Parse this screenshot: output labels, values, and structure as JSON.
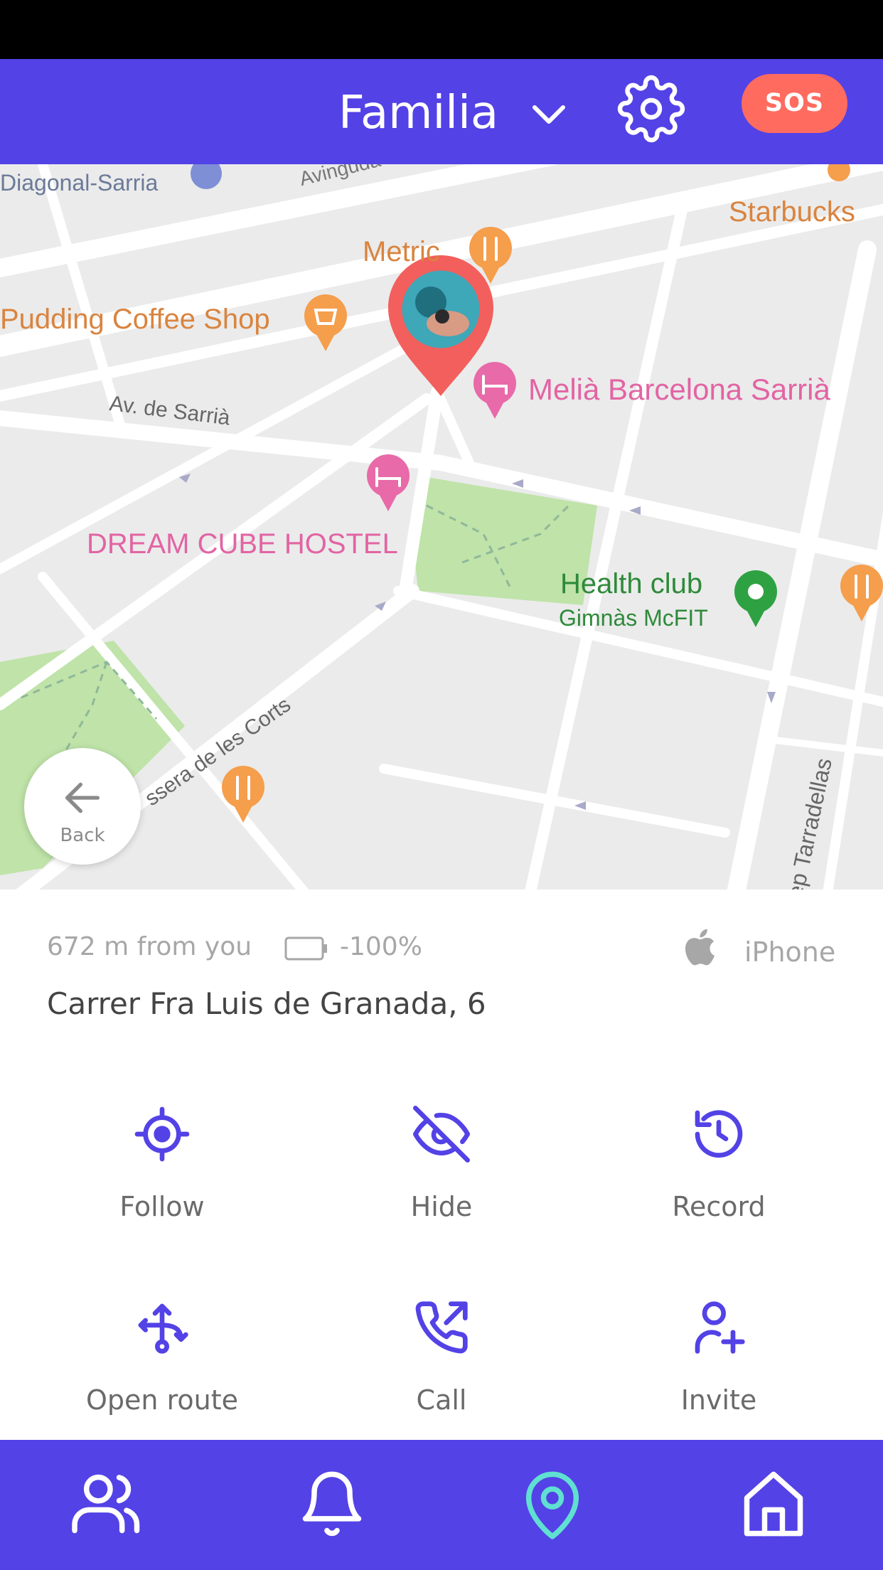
{
  "header": {
    "group_name": "Familia",
    "sos_label": "SOS"
  },
  "map": {
    "labels": {
      "diagonal_sarria": "Diagonal-Sarria",
      "avinguda": "Avinguda",
      "starbucks": "Starbucks",
      "metric": "Metric",
      "pudding_coffee": "Pudding Coffee Shop",
      "melia": "Melià Barcelona Sarrià",
      "av_sarria": "Av. de Sarrià",
      "dream_cube": "DREAM CUBE HOSTEL",
      "health_club": "Health club",
      "gimnas": "Gimnàs McFIT",
      "travessera": "ssera de les Corts",
      "tarradellas": "ep Tarradellas"
    },
    "back_label": "Back"
  },
  "info": {
    "distance": "672 m from you",
    "battery": "-100%",
    "device": "iPhone",
    "address": "Carrer Fra Luis de Granada, 6"
  },
  "actions": {
    "follow": "Follow",
    "hide": "Hide",
    "record": "Record",
    "open_route": "Open route",
    "call": "Call",
    "invite": "Invite"
  },
  "icons": {
    "header": [
      "chevron-down-icon",
      "gear-icon"
    ],
    "info": [
      "battery-icon",
      "apple-icon"
    ],
    "actions": [
      "crosshair-icon",
      "eye-off-icon",
      "history-icon",
      "route-split-icon",
      "phone-outgoing-icon",
      "user-plus-icon"
    ],
    "tabs": [
      "people-icon",
      "bell-icon",
      "location-pin-icon",
      "home-icon"
    ]
  },
  "colors": {
    "brand": "#5342e6",
    "sos": "#ff6b5f",
    "active_tab": "#5fe0d0",
    "action_icon": "#5342e6"
  }
}
